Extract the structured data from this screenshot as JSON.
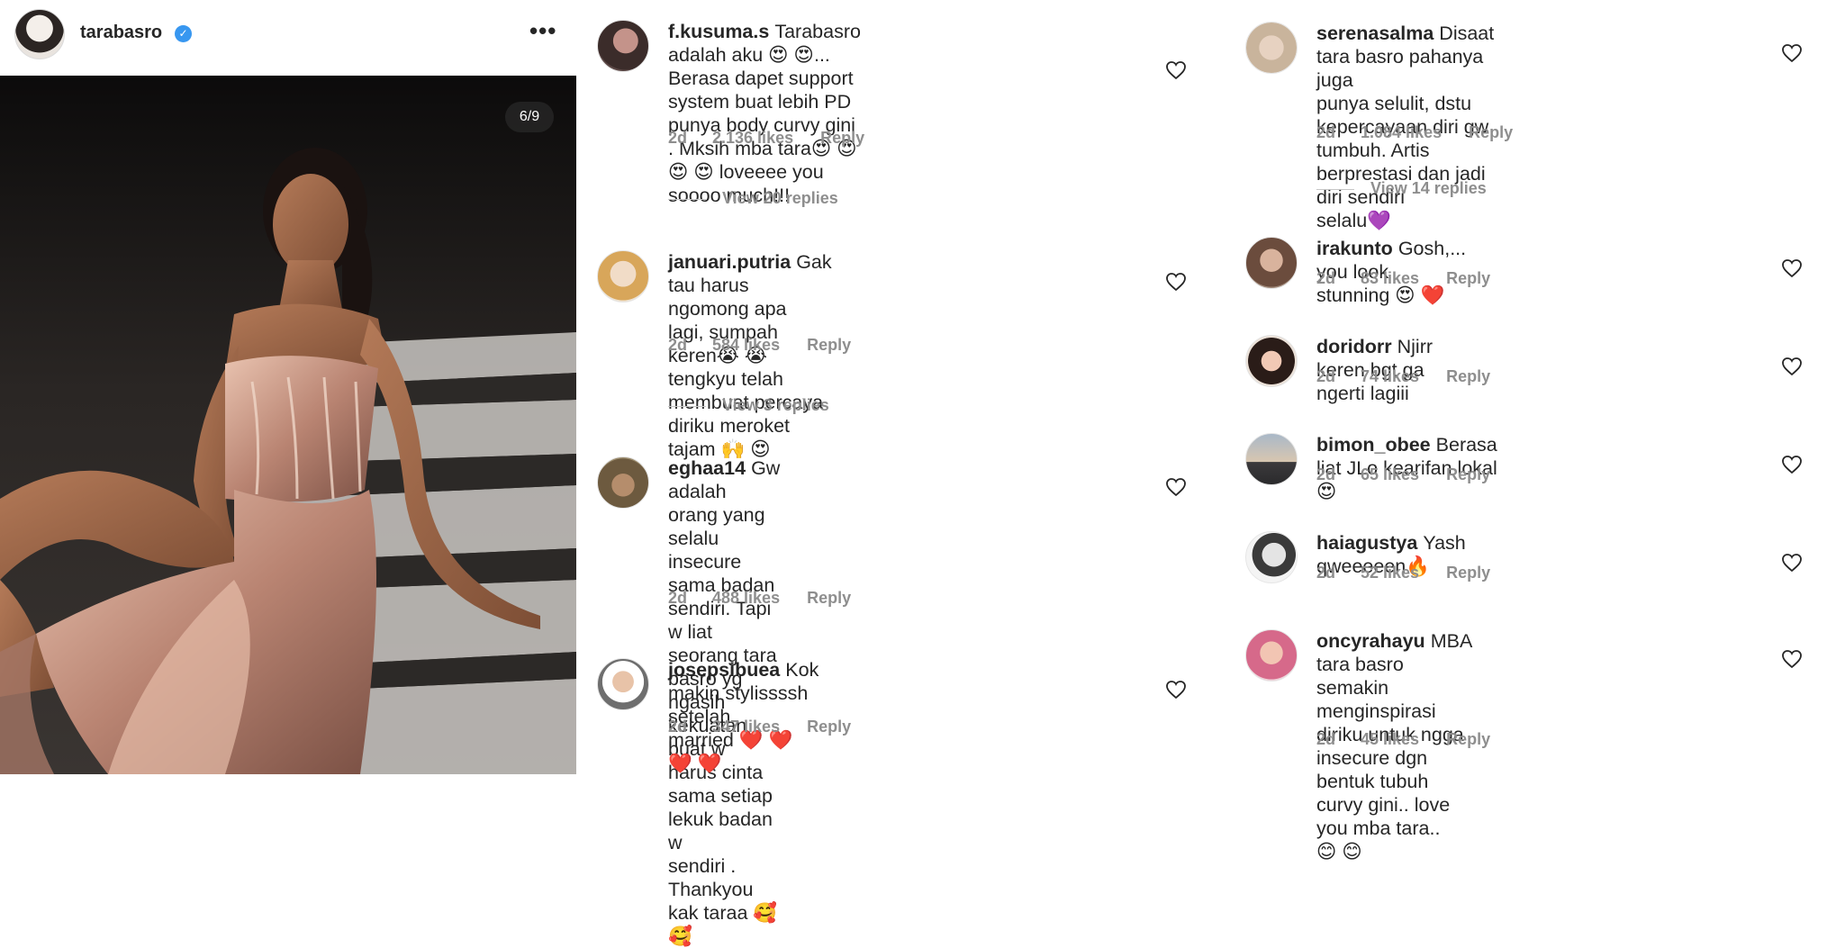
{
  "post": {
    "username": "tarabasro",
    "verified_mark": "✓",
    "more_label": "•••",
    "image_counter": "6/9",
    "colors": {
      "verified": "#3897f0",
      "dress": "#c89a86"
    }
  },
  "columns": [
    {
      "comments": [
        {
          "username": "f.kusuma.s",
          "lines": [
            "Tarabasro adalah aku 😍 😍...",
            "Berasa dapet support system buat lebih PD",
            "punya body curvy gini . Mksih mba tara😍 😍",
            "😍 😍 loveeee you soooo much!!!"
          ],
          "time": "2d",
          "likes": "2.136 likes",
          "reply": "Reply",
          "view_replies": "View 20 replies",
          "avatar_icon": "user-avatar-icon"
        },
        {
          "username": "januari.putria",
          "lines": [
            "Gak tau harus ngomong apa",
            "lagi, sumpah keren😭 😭 tengkyu telah",
            "membuat percaya diriku meroket tajam 🙌 😍"
          ],
          "time": "2d",
          "likes": "584 likes",
          "reply": "Reply",
          "view_replies": "View 3 replies",
          "avatar_icon": "user-avatar-icon"
        },
        {
          "username": "eghaa14",
          "lines": [
            "Gw adalah orang yang selalu",
            "insecure sama badan sendiri. Tapi w liat",
            "seorang tara basro yg ngasih kekuatan buat w",
            "harus cinta sama setiap lekuk badan w",
            "sendiri . Thankyou kak taraa 🥰 🥰"
          ],
          "time": "2d",
          "likes": "488 likes",
          "reply": "Reply",
          "avatar_icon": "user-avatar-icon"
        },
        {
          "username": "josepsibuea",
          "lines": [
            "Kok makin stylissssh setelah",
            "married ❤️ ❤️ ❤️ ❤️"
          ],
          "time": "2d",
          "likes": "347 likes",
          "reply": "Reply",
          "avatar_icon": "user-avatar-icon"
        }
      ]
    },
    {
      "comments": [
        {
          "username": "serenasalma",
          "lines": [
            "Disaat tara basro pahanya juga",
            "punya selulit, dstu kepercayaan diri gw",
            "tumbuh. Artis berprestasi dan jadi diri sendiri",
            "selalu💜"
          ],
          "time": "2d",
          "likes": "1.084 likes",
          "reply": "Reply",
          "view_replies": "View 14 replies",
          "avatar_icon": "user-avatar-icon"
        },
        {
          "username": "irakunto",
          "lines": [
            "Gosh,... you look stunning 😍 ❤️"
          ],
          "time": "2d",
          "likes": "83 likes",
          "reply": "Reply",
          "avatar_icon": "user-avatar-icon"
        },
        {
          "username": "doridorr",
          "lines": [
            "Njirr keren bgt ga ngerti lagiii"
          ],
          "time": "2d",
          "likes": "74 likes",
          "reply": "Reply",
          "avatar_icon": "user-avatar-icon"
        },
        {
          "username": "bimon_obee",
          "lines": [
            "Berasa liat JLo kearifan lokal 😍"
          ],
          "time": "2d",
          "likes": "65 likes",
          "reply": "Reply",
          "avatar_icon": "user-avatar-icon"
        },
        {
          "username": "haiagustya",
          "lines": [
            "Yash qweeeeen🔥"
          ],
          "time": "2d",
          "likes": "52 likes",
          "reply": "Reply",
          "avatar_icon": "user-avatar-icon"
        },
        {
          "username": "oncyrahayu",
          "lines": [
            "MBA tara basro semakin",
            "menginspirasi diriku untuk ngga insecure dgn",
            "bentuk tubuh curvy gini.. love you mba tara..",
            "😊 😊"
          ],
          "time": "2d",
          "likes": "45 likes",
          "reply": "Reply",
          "avatar_icon": "user-avatar-icon"
        }
      ]
    }
  ]
}
